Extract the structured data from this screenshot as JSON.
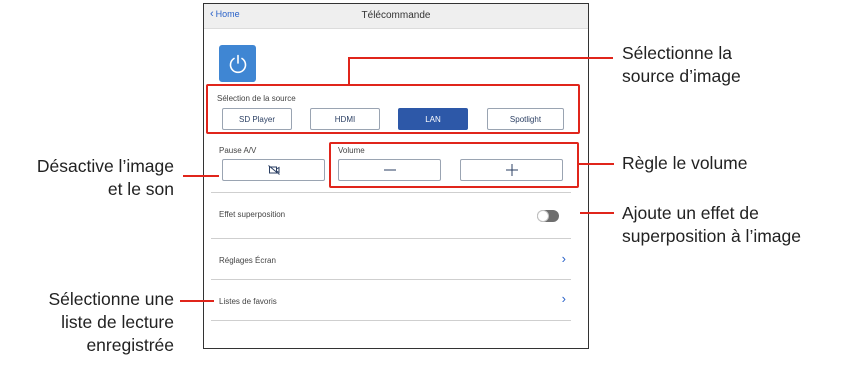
{
  "header": {
    "back_label": "Home",
    "title": "Télécommande"
  },
  "power": {
    "icon": "power-icon",
    "color": "#3f86d3"
  },
  "source": {
    "label": "Sélection de la source",
    "buttons": [
      "SD Player",
      "HDMI",
      "LAN",
      "Spotlight"
    ],
    "selected": "LAN"
  },
  "av_mute": {
    "label": "Pause A/V",
    "icon": "mute-icon"
  },
  "volume": {
    "label": "Volume",
    "down_icon": "minus-icon",
    "up_icon": "plus-icon"
  },
  "rows": [
    {
      "label": "Effet superposition",
      "control": "toggle",
      "value": false
    },
    {
      "label": "Réglages Écran",
      "control": "chevron"
    },
    {
      "label": "Listes de favoris",
      "control": "chevron"
    }
  ],
  "callouts": {
    "source_line1": "Sélectionne la",
    "source_line2": "source d’image",
    "volume": "Règle le volume",
    "overlay_line1": "Ajoute un effet de",
    "overlay_line2": "superposition à l’image",
    "av_line1": "Désactive l’image",
    "av_line2": "et le son",
    "playlist_line1": "Sélectionne une",
    "playlist_line2": "liste de lecture",
    "playlist_line3": "enregistrée"
  },
  "colors": {
    "accent": "#2d58a8",
    "highlight": "#e0251b",
    "link": "#2a62c9"
  }
}
